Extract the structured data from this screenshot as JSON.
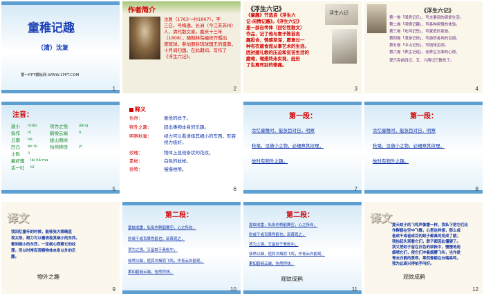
{
  "slides": [
    {
      "number": "1",
      "title": "童稚记趣",
      "author": "（清）沈复",
      "footer": "第一PPT模板网-WWW.1PPT.COM"
    },
    {
      "number": "2",
      "heading": "作者简介",
      "bio": [
        "沈复（1763～约1807），字",
        "三白，号梅逸，长洲（今江苏苏州）",
        "人，清代散文家。嘉庆十三年",
        "（1808），随翰林院编修齐鲲出",
        "使琉球，参加册封琉球国王的盛典，",
        "十月间归国。在此期间，写作了",
        "《浮生六记》。"
      ]
    },
    {
      "number": "3",
      "title": "《浮生六记》",
      "text": [
        "《童趣》节选自《浮生六",
        "记·闲情记趣》。《浮生六记》",
        "是一部自传体（回忆性散文）",
        "作品，记了他与妻子陈芸志",
        "趣投合，情感至深，愿意过一",
        "种布衣蔬食而从事艺术的生活。",
        "因封建礼教的压迫和贫苦生活的",
        "磨难，理想终未实现，经历",
        "了生离死别的惨痛。"
      ],
      "book": "浮生六记"
    },
    {
      "number": "4",
      "title": "《浮生六记》",
      "items": [
        "第一卷「闺房记乐」，写夫妻间的恩爱生活。",
        "第二卷「闲情记趣」，写各种闲情的体验。",
        "第三卷「坎坷记愁」，写家庭的变故。",
        "第四卷「浪游记快」，写游历各地的见闻。",
        "第五卷「中山记历」，写琉球见闻。",
        "第六卷「养生记道」，谈养生方面的心得。"
      ],
      "note": "现只存前四记，五、六两记已散佚了。"
    },
    {
      "number": "5",
      "title": "注音：",
      "left": [
        {
          "w": "藐小",
          "p": "miǎo"
        },
        {
          "w": "项为之强",
          "p": "jiàng"
        },
        {
          "w": "拟作",
          "p": "nǐ"
        },
        {
          "w": "鹤唳云端",
          "p": "lì"
        },
        {
          "w": "丘壑",
          "p": "hè"
        },
        {
          "w": "拔山倒树",
          "p": ""
        },
        {
          "w": "凹凸",
          "p": "āo tū"
        },
        {
          "w": "怡然称快",
          "p": "yí"
        },
        {
          "w": "土砾",
          "p": "lì"
        },
        {
          "w": "癞虾蟆",
          "p": "lài há ma"
        },
        {
          "w": "舌一吐",
          "p": "tǔ"
        }
      ]
    },
    {
      "number": "6",
      "title": "释义",
      "pairs": [
        {
          "k": "怡然：",
          "v": "喜悦的样子。"
        },
        {
          "k": "物外之趣：",
          "v": "超出事物本身的乐趣。"
        },
        {
          "k": "明察秋毫：",
          "v": "视力可以看清极其细小的东西，形容视力极好。"
        },
        {
          "k": "纹理：",
          "v": "物体上显现条状的花纹。"
        },
        {
          "k": "素帐：",
          "v": "白色的蚊帐。"
        },
        {
          "k": "徐喷：",
          "v": "慢慢地喷。"
        }
      ]
    },
    {
      "number": "7",
      "title": "第一段：",
      "lines": [
        "余忆童稚时，能张目对日，明察",
        "秋毫，见藐小之物，必细察其纹理，",
        "故时有物外之趣。"
      ]
    },
    {
      "number": "8",
      "title": "第一段：",
      "lines": [
        "余忆童稚时，能张目对日，明察",
        "秋毫，见藐小之物，必细察其纹理，",
        "故时有物外之趣。"
      ]
    },
    {
      "number": "9",
      "title": "译文",
      "text": [
        "我回忆童年的时候，能够张大眼睛直",
        "视太阳，眼力可以看清极其细小的东西。",
        "看到细小的东西，一定细心观察它的纹",
        "理，所以时常有观察物体本身以外的乐",
        "趣。"
      ],
      "caption": "物外之趣"
    },
    {
      "number": "10",
      "title": "第二段：",
      "lines": [
        "夏蚊成雷，私拟作群鹤舞空，心之所向，",
        "则或千或百果然鹤也；昂首观之，",
        "项为之强。又留蚊于素帐中，",
        "徐喷以烟，使其冲烟而飞鸣，作青云白鹤观，",
        "果如鹤唳云端，怡然称快。"
      ]
    },
    {
      "number": "11",
      "title": "第二段：",
      "lines": [
        "夏蚊成雷，私拟作群鹤舞空，心之所向，",
        "则或千或百果然鹤也；昂首观之，",
        "项为之强。又留蚊于素帐中，",
        "徐喷以烟，使其冲烟而飞鸣，作青云白鹤观，",
        "果如鹤唳云端，怡然称快。"
      ],
      "caption": "观蚊成鹤"
    },
    {
      "number": "12",
      "title": "译文",
      "text": [
        "夏天蚊子的飞鸣声像雷一样，我私下把它们比",
        "作群鹤在空中飞舞，心里这样想，那么或",
        "者成千或者成百的蚊子都真的变成了鹤；",
        "我抬起头观看它们，脖子都因此僵硬了。",
        "我又把蚊子留在白色的蚊帐中，慢慢地用",
        "烟喷它们，使它们冲着烟雾飞叫，当作是",
        "青云白鹤的景观，果然像鹤在云端高鸣，",
        "我为此高兴得拍手叫好。"
      ],
      "caption": "观蚊成鹤"
    }
  ],
  "colors": {
    "accent": "#5d9fd0",
    "red": "#d40000",
    "blue": "#1236a8",
    "olive": "#6e7f2a"
  }
}
